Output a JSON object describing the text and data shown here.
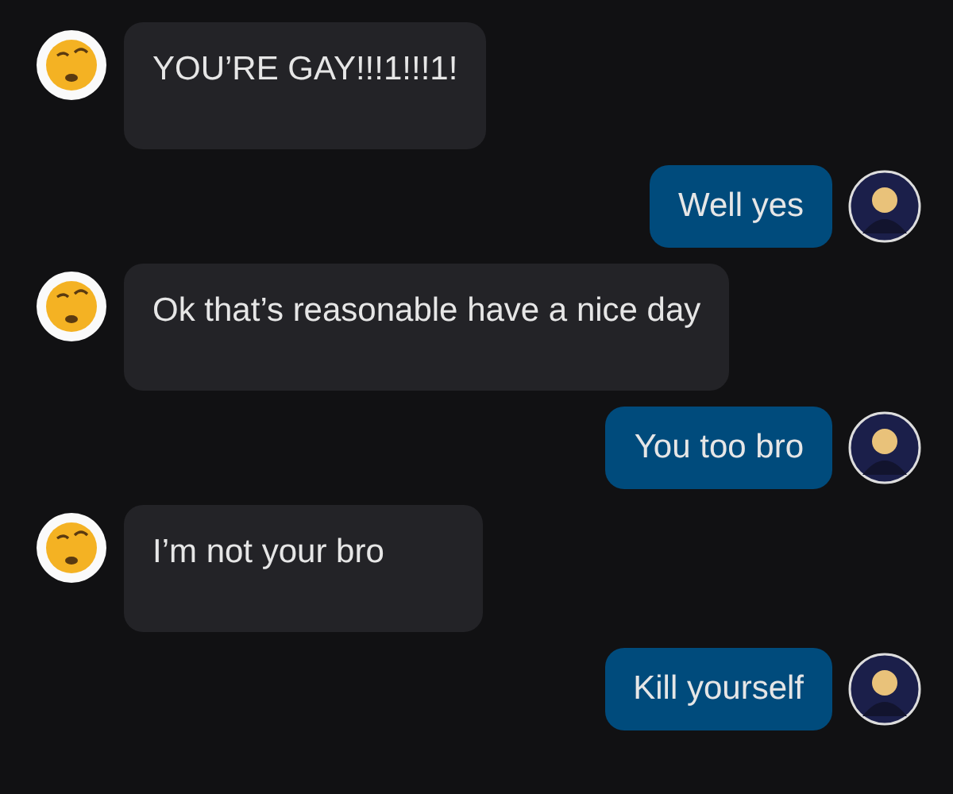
{
  "messages": [
    {
      "kind": "incoming",
      "text": "YOU’RE GAY!!!1!!!1!"
    },
    {
      "kind": "outgoing",
      "text": "Well yes"
    },
    {
      "kind": "incoming",
      "text": "Ok that’s reasonable have a nice day"
    },
    {
      "kind": "outgoing",
      "text": "You too bro"
    },
    {
      "kind": "incoming",
      "text": "I’m not your bro"
    },
    {
      "kind": "outgoing",
      "text": "Kill yourself"
    }
  ]
}
